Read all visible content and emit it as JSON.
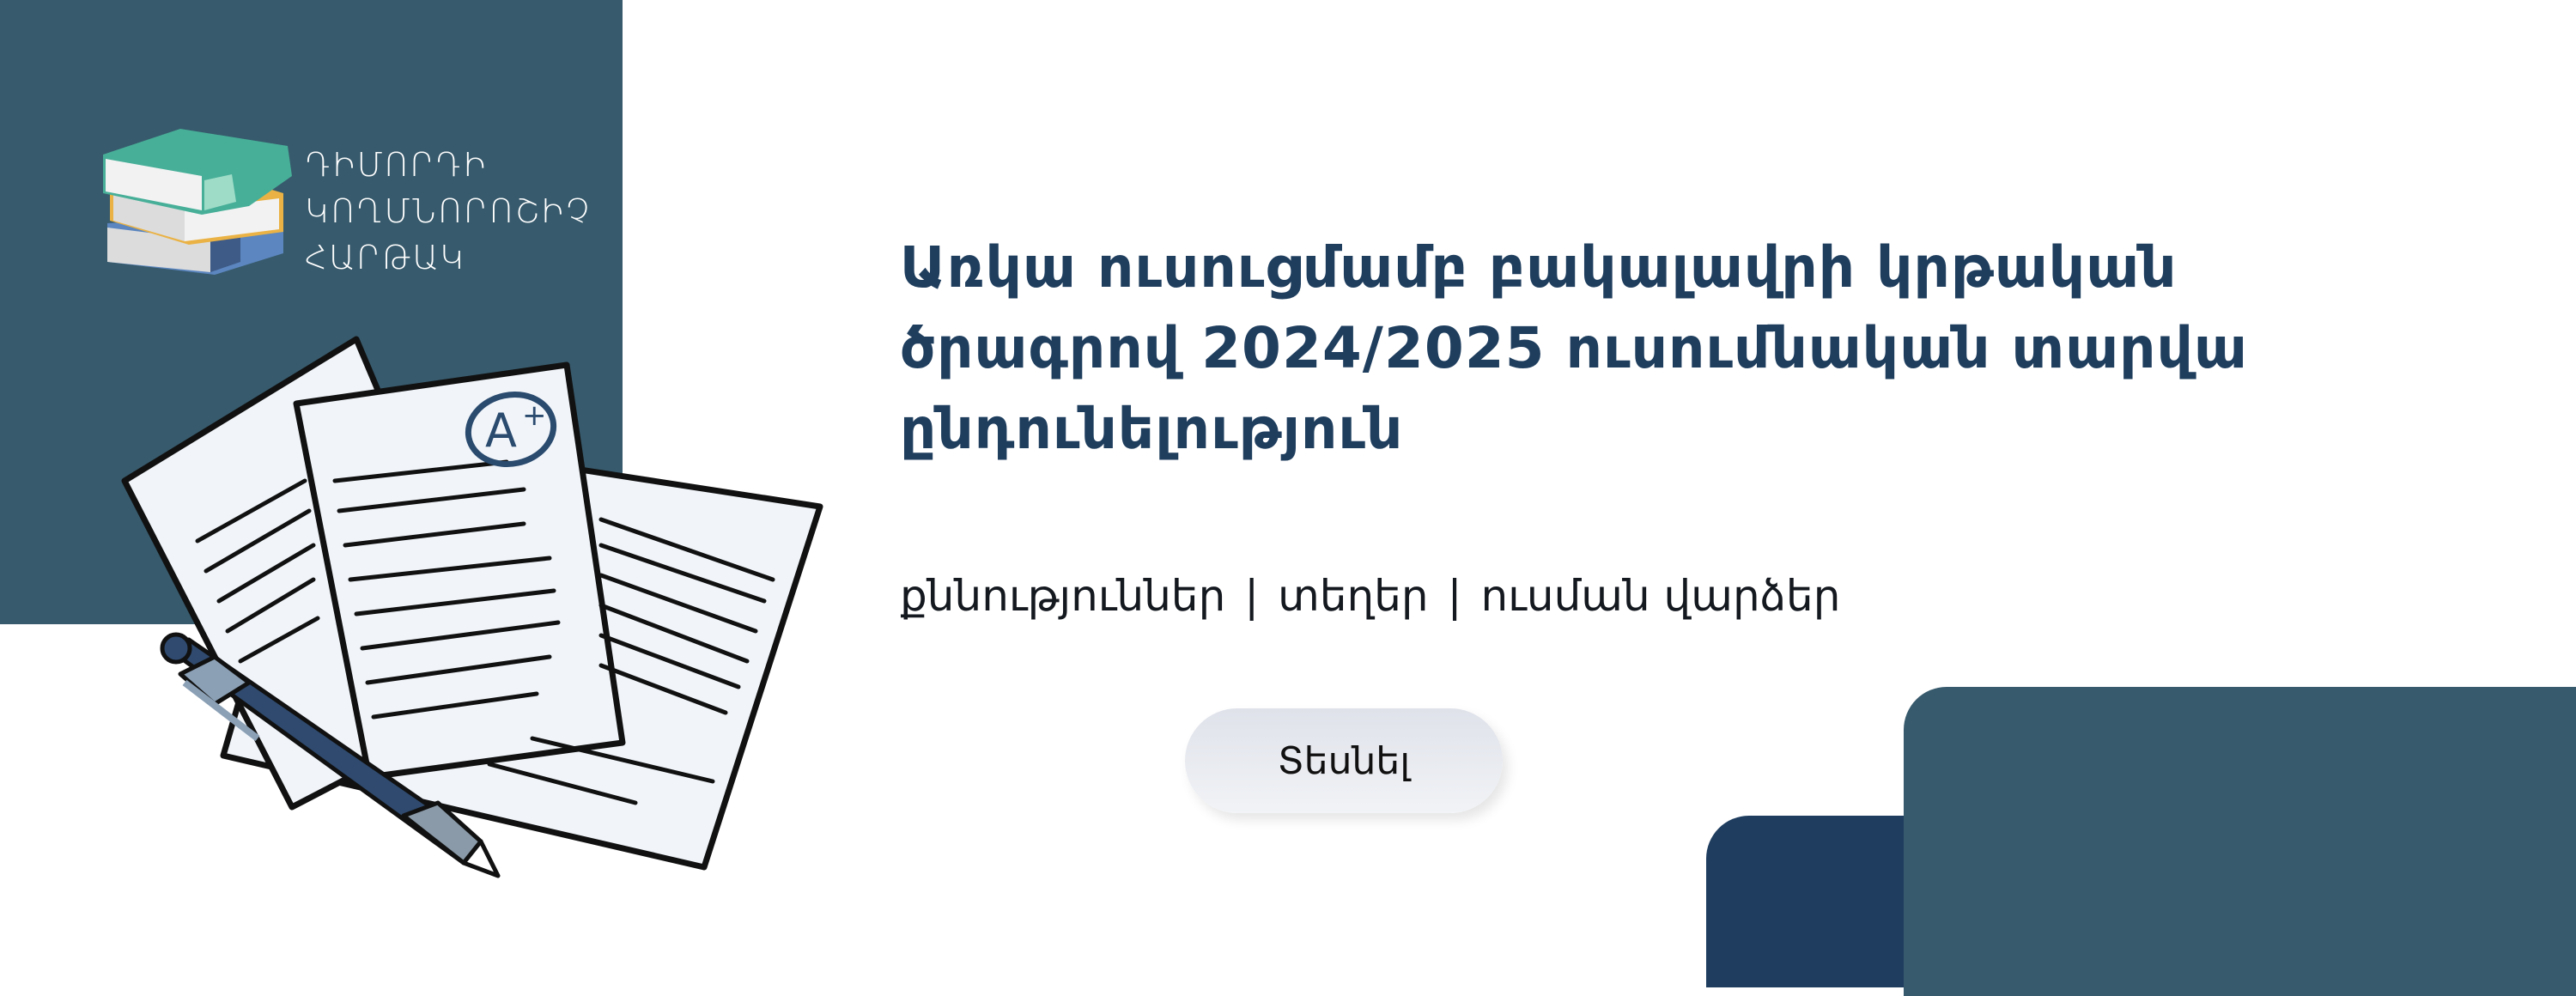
{
  "logo": {
    "lines": [
      "ԴԻՄՈՐԴԻ",
      "ԿՈՂՄՆՈՐՈՇԻՉ",
      "ՀԱՐԹԱԿ"
    ]
  },
  "headline": {
    "lines": [
      "Առկա ուսուցմամբ բակալավրի կրթական",
      "ծրագրով 2024/2025 ուսումնական տարվա",
      "ընդունելություն"
    ]
  },
  "subtitle": {
    "items": [
      "քննություններ",
      "տեղեր",
      "ուսման վարձեր"
    ],
    "separator": "|"
  },
  "cta": {
    "label": "Տեսնել"
  },
  "colors": {
    "panel": "#375a6c",
    "title": "#1f3e5e",
    "navy": "#1e3d5f"
  }
}
